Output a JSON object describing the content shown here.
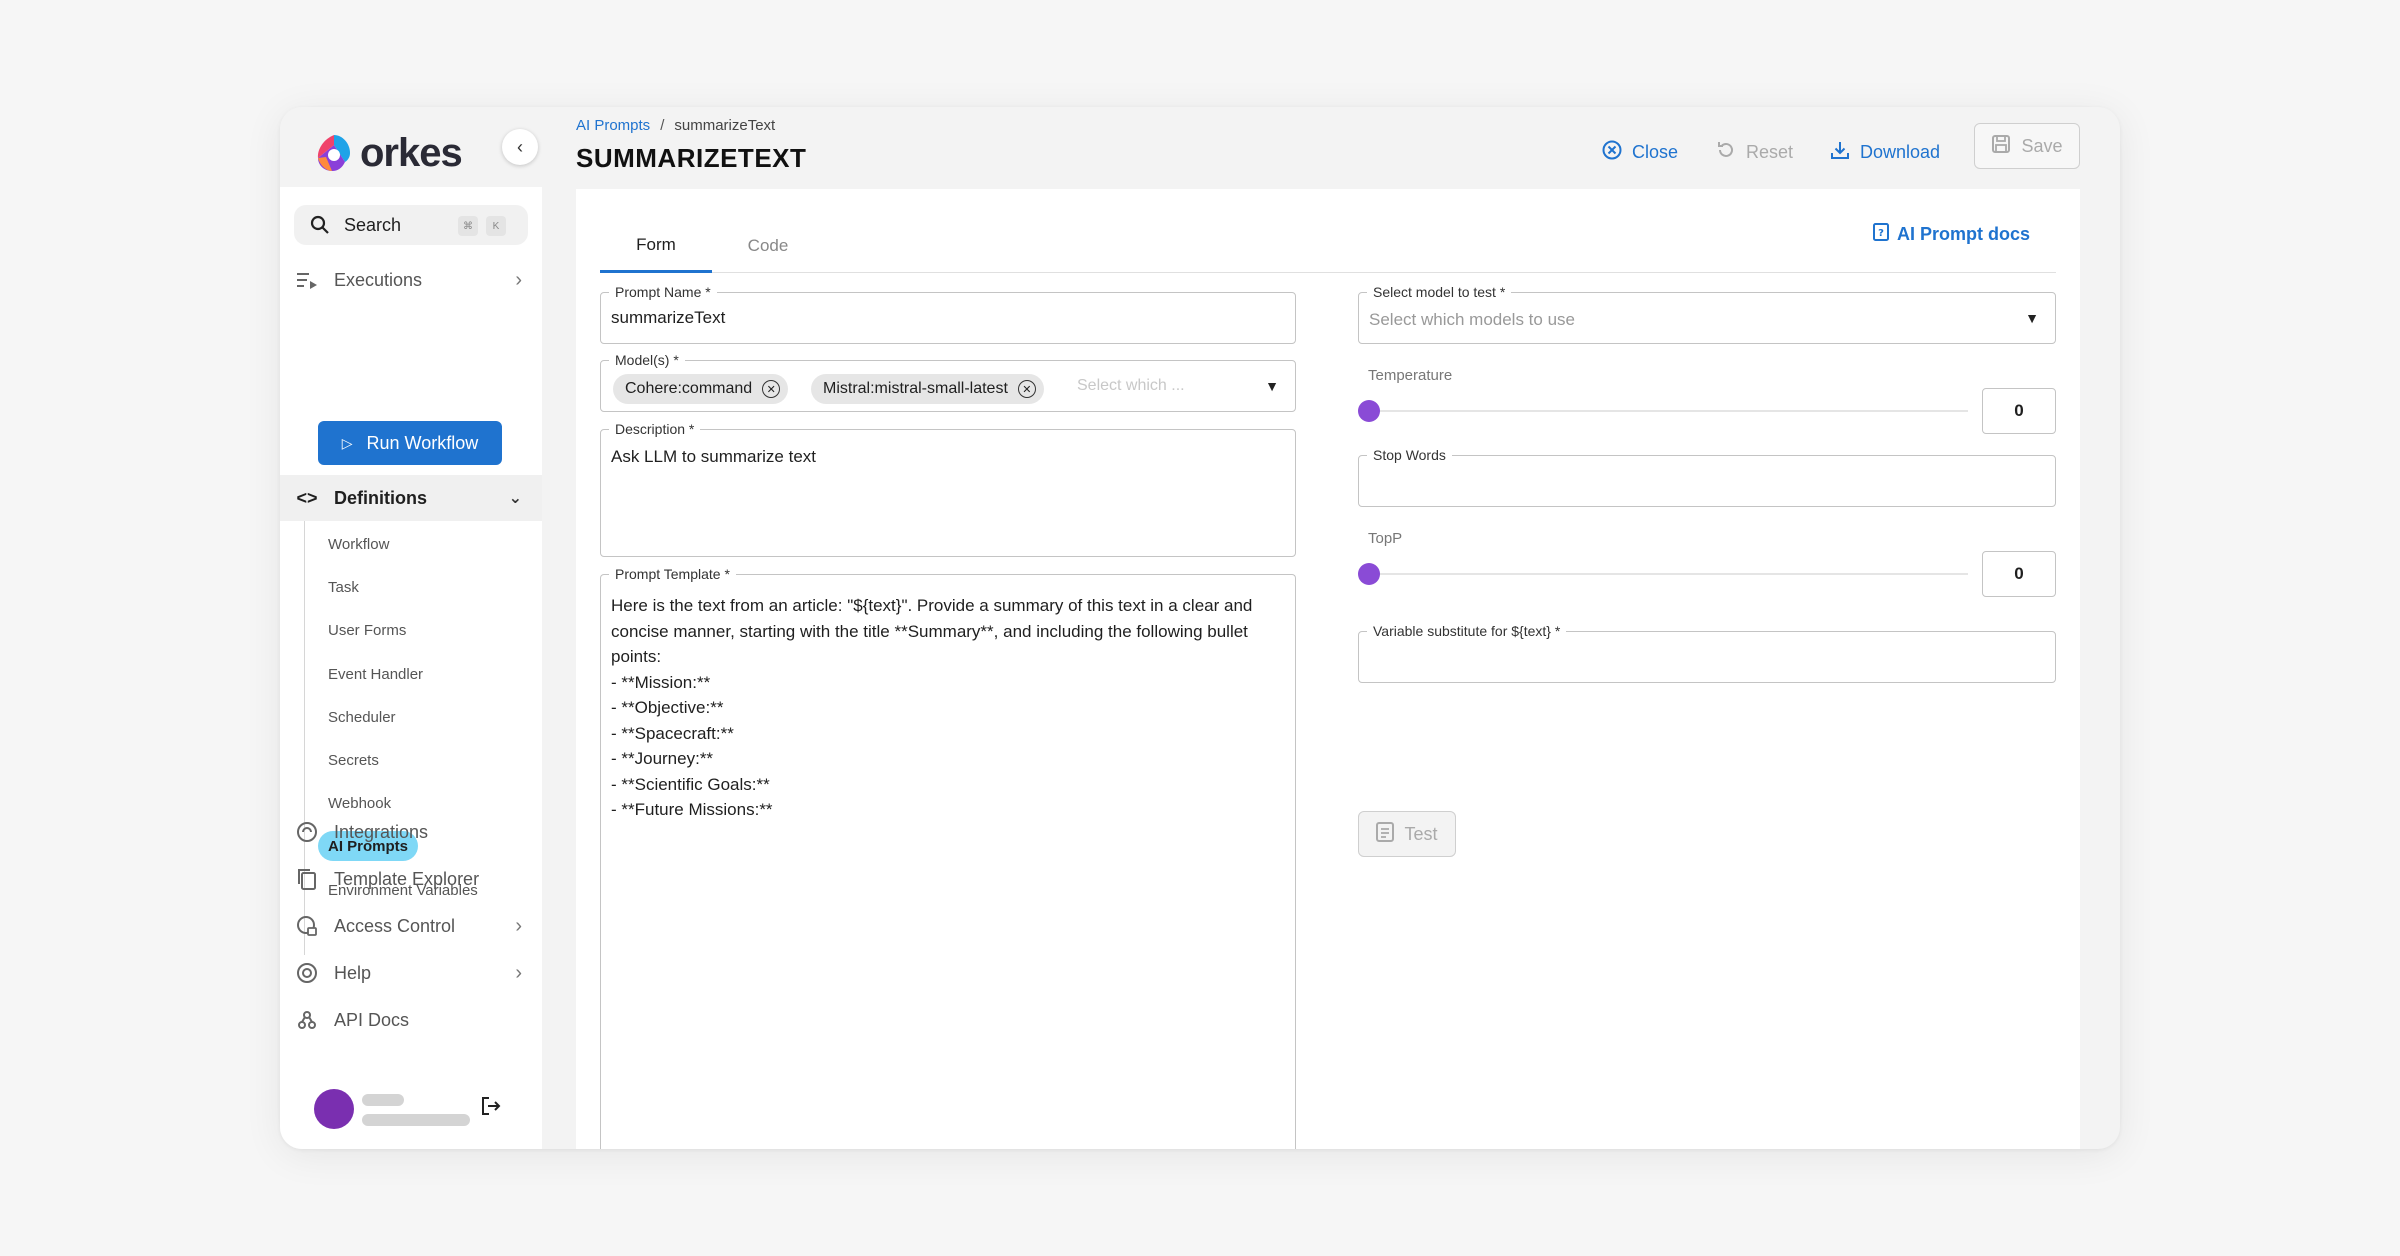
{
  "brand": {
    "name": "orkes"
  },
  "sidebar": {
    "search_label": "Search",
    "search_shortcut": [
      "⌘",
      "K"
    ],
    "executions_label": "Executions",
    "run_workflow_label": "Run Workflow",
    "definitions_label": "Definitions",
    "definitions_items": [
      {
        "label": "Workflow"
      },
      {
        "label": "Task"
      },
      {
        "label": "User Forms"
      },
      {
        "label": "Event Handler"
      },
      {
        "label": "Scheduler"
      },
      {
        "label": "Secrets"
      },
      {
        "label": "Webhook"
      },
      {
        "label": "AI Prompts",
        "active": true
      },
      {
        "label": "Environment Variables"
      }
    ],
    "integrations_label": "Integrations",
    "template_explorer_label": "Template Explorer",
    "access_control_label": "Access Control",
    "help_label": "Help",
    "api_docs_label": "API Docs"
  },
  "header": {
    "breadcrumb_parent": "AI Prompts",
    "breadcrumb_separator": "/",
    "breadcrumb_current": "summarizeText",
    "title": "SUMMARIZETEXT",
    "close_label": "Close",
    "reset_label": "Reset",
    "download_label": "Download",
    "save_label": "Save"
  },
  "tabs": {
    "form": "Form",
    "code": "Code",
    "active": "Form"
  },
  "docs_link_label": "AI Prompt docs",
  "form": {
    "prompt_name_label": "Prompt Name *",
    "prompt_name_value": "summarizeText",
    "models_label": "Model(s) *",
    "models": [
      "Cohere:command",
      "Mistral:mistral-small-latest"
    ],
    "models_placeholder": "Select which ...",
    "description_label": "Description *",
    "description_value": "Ask LLM to summarize text",
    "template_label": "Prompt Template *",
    "template_value": "Here is the text from an article: \"${text}\". Provide a summary of this text in a clear and concise manner, starting with the title **Summary**, and including the following bullet points:\n- **Mission:**\n- **Objective:**\n- **Spacecraft:**\n- **Journey:**\n- **Scientific Goals:**\n- **Future Missions:**"
  },
  "test_panel": {
    "model_select_label": "Select model to test *",
    "model_select_placeholder": "Select which models to use",
    "temperature_label": "Temperature",
    "temperature_value": "0",
    "stop_words_label": "Stop Words",
    "stop_words_value": "",
    "topp_label": "TopP",
    "topp_value": "0",
    "variable_label": "Variable substitute for ${text} *",
    "variable_value": "",
    "test_label": "Test"
  },
  "colors": {
    "accent": "#1f73cf",
    "active_nav": "#7fd8f6",
    "slider_thumb": "#8a4bd6",
    "avatar": "#7a2fb0"
  }
}
